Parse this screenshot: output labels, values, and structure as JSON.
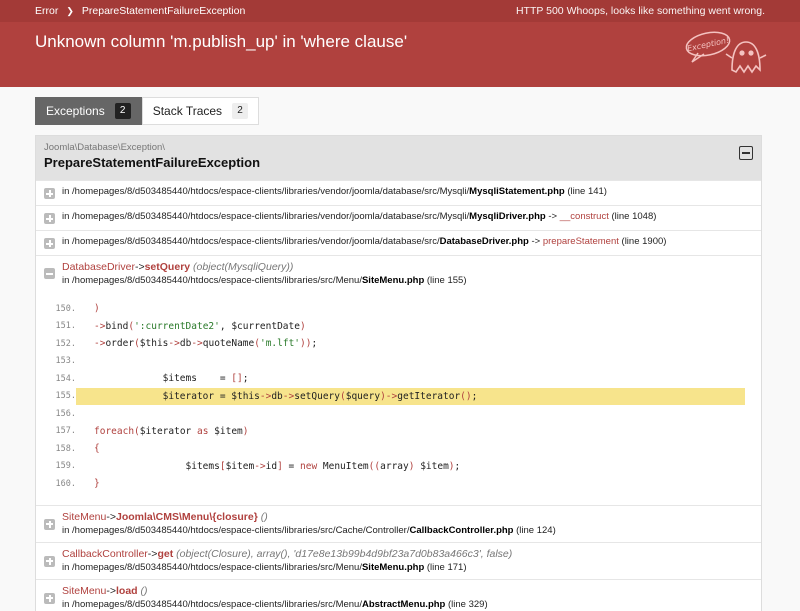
{
  "topbar": {
    "crumb_root": "Error",
    "crumb_current": "PrepareStatementFailureException",
    "http_status": "HTTP 500",
    "http_message": "Whoops, looks like something went wrong."
  },
  "error_message": "Unknown column 'm.publish_up' in 'where clause'",
  "logo_text": "Exception!",
  "tabs": [
    {
      "label": "Exceptions",
      "count": "2",
      "active": true
    },
    {
      "label": "Stack Traces",
      "count": "2",
      "active": false
    }
  ],
  "exception": {
    "namespace": "Joomla\\Database\\Exception\\",
    "class": "PrepareStatementFailureException"
  },
  "traces": [
    {
      "in": "in ",
      "path": "/homepages/8/d503485440/htdocs/espace-clients/libraries/vendor/joomla/database/src/Mysqli/",
      "file": "MysqliStatement.php",
      "line": " (line 141)"
    },
    {
      "in": "in ",
      "path": "/homepages/8/d503485440/htdocs/espace-clients/libraries/vendor/joomla/database/src/Mysqli/",
      "file": "MysqliDriver.php",
      "arrow": " -> ",
      "method": "__construct",
      "line": " (line 1048)"
    },
    {
      "in": "in ",
      "path": "/homepages/8/d503485440/htdocs/espace-clients/libraries/vendor/joomla/database/src/",
      "file": "DatabaseDriver.php",
      "arrow": " -> ",
      "method": "prepareStatement",
      "line": " (line 1900)"
    }
  ],
  "expanded": {
    "class": "DatabaseDriver",
    "arrow": "->",
    "method": "setQuery",
    "args": " (object(MysqliQuery))",
    "in": "in ",
    "path": "/homepages/8/d503485440/htdocs/espace-clients/libraries/src/Menu/",
    "file": "SiteMenu.php",
    "line": " (line 155)"
  },
  "code_lines": [
    {
      "n": "150.",
      "code": "                )"
    },
    {
      "n": "151.",
      "code": "                ->bind(':currentDate2', $currentDate)"
    },
    {
      "n": "152.",
      "code": "                ->order($this->db->quoteName('m.lft'));"
    },
    {
      "n": "153.",
      "code": ""
    },
    {
      "n": "154.",
      "code": "            $items    = [];"
    },
    {
      "n": "155.",
      "code": "            $iterator = $this->db->setQuery($query)->getIterator();"
    },
    {
      "n": "156.",
      "code": ""
    },
    {
      "n": "157.",
      "code": "            foreach ($iterator as $item)"
    },
    {
      "n": "158.",
      "code": "            {"
    },
    {
      "n": "159.",
      "code": "                $items[$item->id] = new MenuItem((array) $item);"
    },
    {
      "n": "160.",
      "code": "            }"
    }
  ],
  "highlight_line": "155.",
  "traces_after": [
    {
      "class": "SiteMenu",
      "arrow": "->",
      "method": "Joomla\\CMS\\Menu\\{closure}",
      "args": " ()",
      "in": "in ",
      "path": "/homepages/8/d503485440/htdocs/espace-clients/libraries/src/Cache/Controller/",
      "file": "CallbackController.php",
      "line": " (line 124)"
    },
    {
      "class": "CallbackController",
      "arrow": "->",
      "method": "get",
      "args": " (object(Closure), array(), 'd17e8e13b99b4d9bf23a7d0b83a466c3', false)",
      "in": "in ",
      "path": "/homepages/8/d503485440/htdocs/espace-clients/libraries/src/Menu/",
      "file": "SiteMenu.php",
      "line": " (line 171)"
    },
    {
      "class": "SiteMenu",
      "arrow": "->",
      "method": "load",
      "args": " ()",
      "in": "in ",
      "path": "/homepages/8/d503485440/htdocs/espace-clients/libraries/src/Menu/",
      "file": "AbstractMenu.php",
      "line": " (line 329)"
    }
  ],
  "colors": {
    "header": "#b0413e",
    "highlight": "#f7e48c",
    "accent": "#b0413e"
  }
}
